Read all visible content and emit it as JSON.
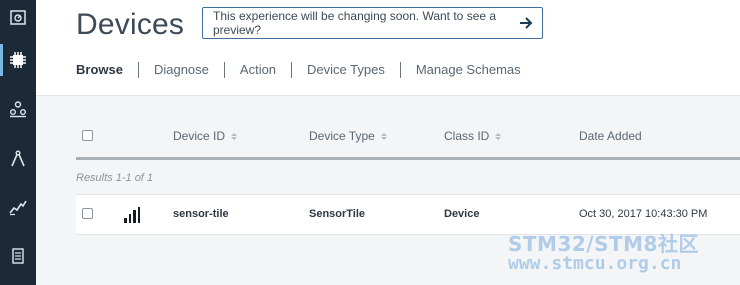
{
  "page": {
    "title": "Devices"
  },
  "banner": {
    "text": "This experience will be changing soon. Want to see a preview?"
  },
  "rail": {
    "items": [
      {
        "icon": "dashboard-icon"
      },
      {
        "icon": "chip-icon",
        "active": true
      },
      {
        "icon": "members-icon"
      },
      {
        "icon": "compass-icon"
      },
      {
        "icon": "usage-chart-icon"
      },
      {
        "icon": "document-icon"
      }
    ]
  },
  "tabs": [
    "Browse",
    "Diagnose",
    "Action",
    "Device Types",
    "Manage Schemas"
  ],
  "table": {
    "columns": [
      "Device ID",
      "Device Type",
      "Class ID",
      "Date Added"
    ],
    "results": "Results 1-1 of 1",
    "rows": [
      {
        "device_id": "sensor-tile",
        "device_type": "SensorTile",
        "class_id": "Device",
        "date_added": "Oct 30, 2017 10:43:30 PM"
      }
    ]
  },
  "watermark": {
    "line1": "STM32/STM8社区",
    "line2": "www.stmcu.org.cn"
  },
  "colors": {
    "rail": "#1c2a38",
    "banner_border": "#3f6f9c",
    "content_bg": "#f4f5f7"
  }
}
